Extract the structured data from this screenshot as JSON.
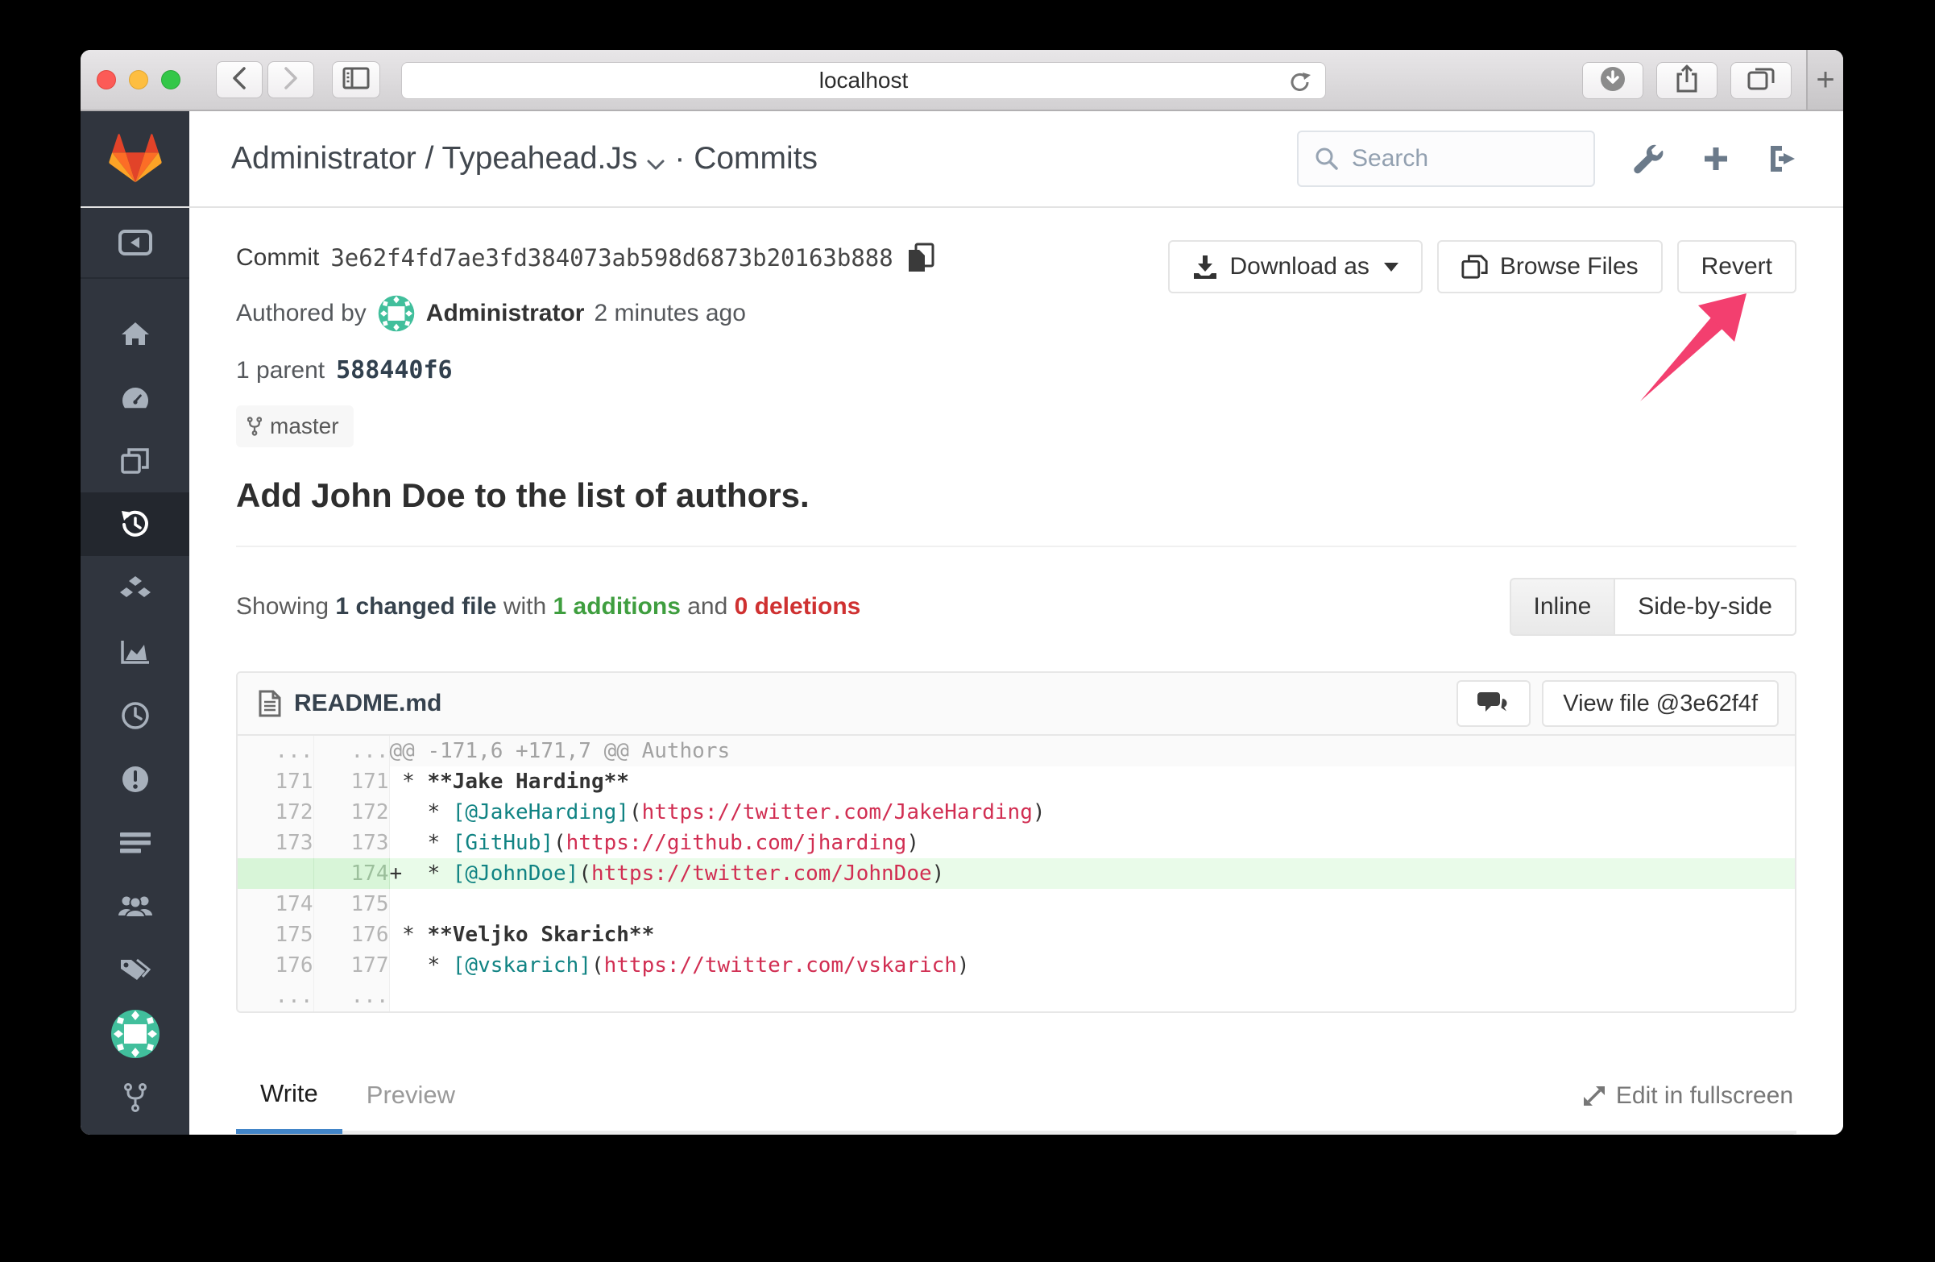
{
  "browser": {
    "url": "localhost",
    "new_tab": "+"
  },
  "header": {
    "breadcrumb": "Administrator / Typeahead.Js",
    "section": "· Commits",
    "search_placeholder": "Search"
  },
  "commit": {
    "label": "Commit",
    "sha": "3e62f4fd7ae3fd384073ab598d6873b20163b888",
    "authored_by": "Authored by",
    "author": "Administrator",
    "time_ago": "2 minutes ago",
    "parent_label": "1 parent",
    "parent_sha": "588440f6",
    "branch": "master",
    "message": "Add John Doe to the list of authors."
  },
  "actions": {
    "download_as": "Download as",
    "browse_files": "Browse Files",
    "revert": "Revert"
  },
  "summary": {
    "showing": "Showing",
    "changed": "1 changed file",
    "with": "with",
    "additions": "1 additions",
    "and": "and",
    "deletions": "0 deletions"
  },
  "view_toggle": {
    "inline": "Inline",
    "side_by_side": "Side-by-side"
  },
  "diff": {
    "filename": "README.md",
    "view_file": "View file @3e62f4f",
    "rows": [
      {
        "type": "match",
        "old": "...",
        "new": "...",
        "segs": [
          {
            "t": "@@ -171,6 +171,7 @@ Authors",
            "c": "h"
          }
        ]
      },
      {
        "type": "ctx",
        "old": "171",
        "new": "171",
        "segs": [
          {
            "t": " * ",
            "c": "p"
          },
          {
            "t": "**Jake Harding**",
            "c": "b"
          }
        ]
      },
      {
        "type": "ctx",
        "old": "172",
        "new": "172",
        "segs": [
          {
            "t": "   * ",
            "c": "p"
          },
          {
            "t": "[@JakeHarding]",
            "c": "l"
          },
          {
            "t": "(",
            "c": "p"
          },
          {
            "t": "https://twitter.com/JakeHarding",
            "c": "u"
          },
          {
            "t": ")",
            "c": "p"
          }
        ]
      },
      {
        "type": "ctx",
        "old": "173",
        "new": "173",
        "segs": [
          {
            "t": "   * ",
            "c": "p"
          },
          {
            "t": "[GitHub]",
            "c": "l"
          },
          {
            "t": "(",
            "c": "p"
          },
          {
            "t": "https://github.com/jharding",
            "c": "u"
          },
          {
            "t": ")",
            "c": "p"
          }
        ]
      },
      {
        "type": "add",
        "old": "",
        "new": "174",
        "segs": [
          {
            "t": "+  * ",
            "c": "p"
          },
          {
            "t": "[@JohnDoe]",
            "c": "l"
          },
          {
            "t": "(",
            "c": "p"
          },
          {
            "t": "https://twitter.com/JohnDoe",
            "c": "u"
          },
          {
            "t": ")",
            "c": "p"
          }
        ]
      },
      {
        "type": "ctx",
        "old": "174",
        "new": "175",
        "segs": []
      },
      {
        "type": "ctx",
        "old": "175",
        "new": "176",
        "segs": [
          {
            "t": " * ",
            "c": "p"
          },
          {
            "t": "**Veljko Skarich**",
            "c": "b"
          }
        ]
      },
      {
        "type": "ctx",
        "old": "176",
        "new": "177",
        "segs": [
          {
            "t": "   * ",
            "c": "p"
          },
          {
            "t": "[@vskarich]",
            "c": "l"
          },
          {
            "t": "(",
            "c": "p"
          },
          {
            "t": "https://twitter.com/vskarich",
            "c": "u"
          },
          {
            "t": ")",
            "c": "p"
          }
        ]
      },
      {
        "type": "match",
        "old": "...",
        "new": "...",
        "segs": []
      }
    ]
  },
  "editor": {
    "write_tab": "Write",
    "preview_tab": "Preview",
    "fullscreen": "Edit in fullscreen"
  },
  "colors": {
    "accent_blue": "#4285c8",
    "arrow_pink": "#f33f6f",
    "added_line_bg": "#e9fbe9",
    "link_teal": "#108383",
    "url_red": "#d12e52",
    "additions_green": "#3f9e3f",
    "deletions_red": "#cf3131",
    "sidebar_bg": "#30353e"
  }
}
